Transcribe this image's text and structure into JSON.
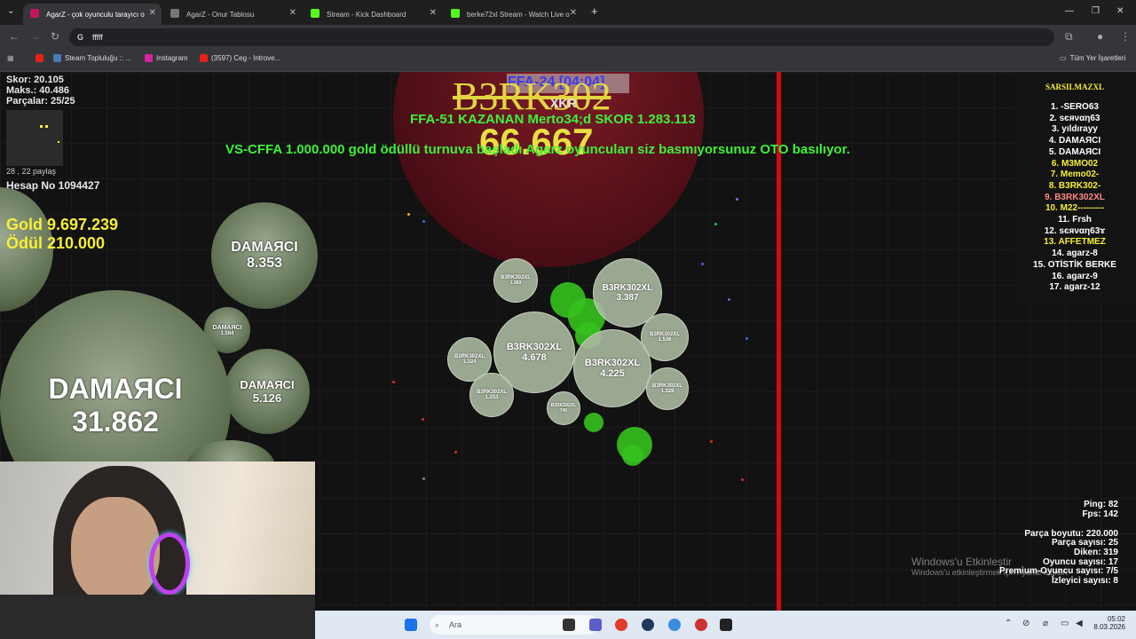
{
  "browser": {
    "tabs": [
      {
        "label": "AgarZ - çok oyunculu tarayıcı o",
        "active": true,
        "color": "#c2185b"
      },
      {
        "label": "AgarZ - Onur Tablosu",
        "active": false,
        "color": "#777777"
      },
      {
        "label": "Stream - Kick Dashboard",
        "active": false,
        "color": "#53fc18"
      },
      {
        "label": "berke72xl Stream - Watch Live o",
        "active": false,
        "color": "#53fc18"
      }
    ],
    "url": "fffff",
    "bookmarks": [
      "Steam Topluluğu :: ...",
      "Instagram",
      "(3597) Ceg - Introve..."
    ],
    "all_bookmarks": "Tüm Yer İşaretleri"
  },
  "hud": {
    "score": "Skor: 20.105",
    "max": "Maks.: 40.486",
    "pieces": "Parçalar: 25/25",
    "share": "28 , 22 paylaş",
    "account": "Hesap No 1094427",
    "gold": "Gold 9.697.239",
    "reward": "Ödül 210.000"
  },
  "center": {
    "timer": "FFA-24 [04:04]",
    "big_name": "B3RK302",
    "tag": "XKR",
    "winner": "FFA-51 KAZANAN Merto34;d SKOR 1.283.113",
    "big_score": "66.667",
    "announcement": "VS-CFFA 1.000.000 gold ödüllü turnuva başladı Agarz oyuncuları siz basmıyorsunuz OTO basılıyor."
  },
  "enemy_cells": [
    {
      "name": "DAMAЯCI",
      "score": "8.353"
    },
    {
      "name": "DAMAЯCI",
      "score": "1.584"
    },
    {
      "name": "DAMAЯCI",
      "score": "5.126"
    },
    {
      "name": "DAMAЯCI",
      "score": "31.862"
    }
  ],
  "player_cells": [
    {
      "name": "B3RK302XL",
      "score": "1.369"
    },
    {
      "name": "B3RK302XL",
      "score": "3.387"
    },
    {
      "name": "B3RK302XL",
      "score": "1.536"
    },
    {
      "name": "B3RK302XL",
      "score": "4.678"
    },
    {
      "name": "B3RK302XL",
      "score": "4.225"
    },
    {
      "name": "B3RK302XL",
      "score": "1.324"
    },
    {
      "name": "B3RK302XL",
      "score": "1.253"
    },
    {
      "name": "B3RK302XL",
      "score": "1.328"
    },
    {
      "name": "B3RK302XL",
      "score": "745"
    }
  ],
  "leaderboard": {
    "title": "SARSILMAZXL",
    "entries": [
      {
        "text": "1. -SERO63",
        "color": "#ffffff"
      },
      {
        "text": "2. sєяναη63",
        "color": "#ffffff"
      },
      {
        "text": "3. yıldırayy",
        "color": "#ffffff"
      },
      {
        "text": "4. DAMAЯCI",
        "color": "#ffffff"
      },
      {
        "text": "5. DAMAЯCI",
        "color": "#ffffff"
      },
      {
        "text": "6. M3MO02",
        "color": "#f7ef36"
      },
      {
        "text": "7. Memo02-",
        "color": "#f7ef36"
      },
      {
        "text": "8. B3RK302-",
        "color": "#f7ef36"
      },
      {
        "text": "9. B3RK302XL",
        "color": "#ff8a8a"
      },
      {
        "text": "10. M22---------",
        "color": "#f7ef36"
      },
      {
        "text": "11. Frsh",
        "color": "#ffffff"
      },
      {
        "text": "12. sєяναη63ɤ",
        "color": "#ffffff"
      },
      {
        "text": "13. AFFETMEZ",
        "color": "#f7ef36"
      },
      {
        "text": "14. agarz-8",
        "color": "#ffffff"
      },
      {
        "text": "15. OTİSTİK BERKE",
        "color": "#ffffff"
      },
      {
        "text": "16. agarz-9",
        "color": "#ffffff"
      },
      {
        "text": "17. agarz-12",
        "color": "#ffffff"
      }
    ]
  },
  "net": {
    "ping": "Ping: 82",
    "fps": "Fps: 142"
  },
  "server": {
    "piece_size": "Parça boyutu: 220.000",
    "piece_count": "Parça sayısı: 25",
    "spikes": "Diken: 319",
    "players": "Oyuncu sayısı: 17",
    "premium": "Premium-Oyuncu sayısı: 7/5",
    "viewers": "İzleyici sayısı: 8"
  },
  "windows": {
    "activate": "Windows'u Etkinleştir",
    "activate_sub": "Windows'u etkinleştirmek için Ayarlar'a gidin.",
    "search": "Ara",
    "time": "05:02",
    "date": "8.03.2026"
  }
}
